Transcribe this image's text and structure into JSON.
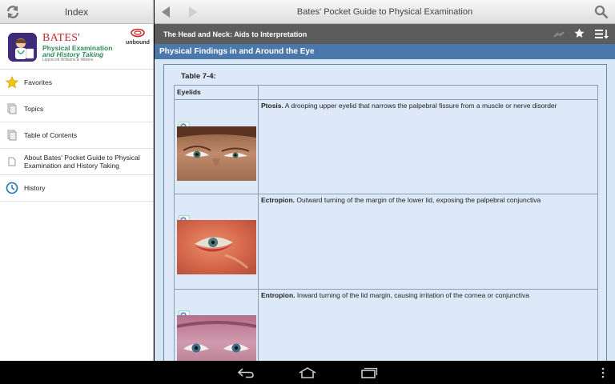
{
  "left_pane": {
    "title": "Index",
    "brand": {
      "name": "BATES'",
      "subtitle_line1": "Physical Examination",
      "subtitle_line2": "and History Taking",
      "publisher": "Lippincott Williams & Wilkins",
      "partner": "unbound"
    },
    "nav_items": [
      {
        "label": "Favorites",
        "icon": "star-icon"
      },
      {
        "label": "Topics",
        "icon": "page-icon"
      },
      {
        "label": "Table of Contents",
        "icon": "page-icon"
      },
      {
        "label": "About Bates' Pocket Guide to Physical Examination and History Taking",
        "icon": "page-icon"
      },
      {
        "label": "History",
        "icon": "clock-icon"
      }
    ]
  },
  "right_pane": {
    "title": "Bates' Pocket Guide to Physical Examination",
    "chapter": "The Head and Neck: Aids to Interpretation",
    "section": "Physical Findings in and Around the Eye",
    "table": {
      "caption": "Table 7-4:",
      "header": "Eyelids",
      "rows": [
        {
          "term": "Ptosis.",
          "description": "A drooping upper eyelid that narrows the palpebral fissure from a muscle or nerve disorder"
        },
        {
          "term": "Ectropion.",
          "description": "Outward turning of the margin of the lower lid, exposing the palpebral conjunctiva"
        },
        {
          "term": "Entropion.",
          "description": "Inward turning of the lid margin, causing irritation of the cornea or conjunctiva"
        }
      ]
    }
  },
  "colors": {
    "chapter_bar": "#5c5c5c",
    "section_bar": "#4a78ab",
    "content_bg": "#d7e6f5",
    "brand_red": "#c62a2a",
    "brand_green": "#2d8c5a",
    "favorites_star": "#f2c40f",
    "history_clock": "#1f6fb5"
  }
}
